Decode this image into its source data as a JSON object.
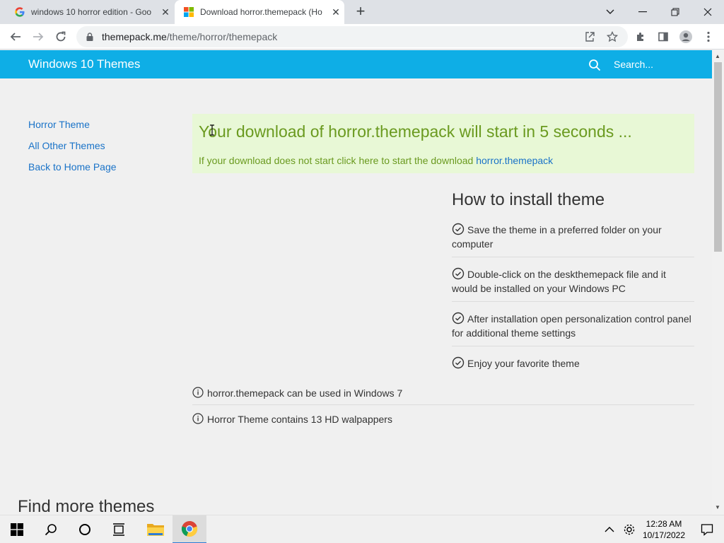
{
  "browser": {
    "tabs": [
      {
        "title": "windows 10 horror edition - Goo",
        "favicon": "google-icon",
        "active": false
      },
      {
        "title": "Download horror.themepack (Ho",
        "favicon": "windows-logo-icon",
        "active": true
      }
    ],
    "url_host": "themepack.me",
    "url_path": "/theme/horror/themepack"
  },
  "site": {
    "brand": "Windows 10 Themes",
    "search_placeholder": "Search...",
    "accent_color": "#0eaee6"
  },
  "sidenav": {
    "items": [
      "Horror Theme",
      "All Other Themes",
      "Back to Home Page"
    ]
  },
  "notice": {
    "headline": "Your download of horror.themepack will start in 5 seconds ...",
    "subtext": "If your download does not start click here to start the download",
    "link": "horror.themepack",
    "text_color": "#6a9a1f",
    "background": "#e8f8d6"
  },
  "install": {
    "title": "How to install theme",
    "steps": [
      "Save the theme in a preferred folder on your computer",
      "Double-click on the deskthemepack file and it would be installed on your Windows PC",
      "After installation open personalization control panel for additional theme settings",
      "Enjoy your favorite theme"
    ]
  },
  "info": [
    "horror.themepack can be used in Windows 7",
    "Horror Theme contains 13 HD walpappers"
  ],
  "find_more": "Find more themes",
  "taskbar": {
    "time": "12:28 AM",
    "date": "10/17/2022"
  }
}
